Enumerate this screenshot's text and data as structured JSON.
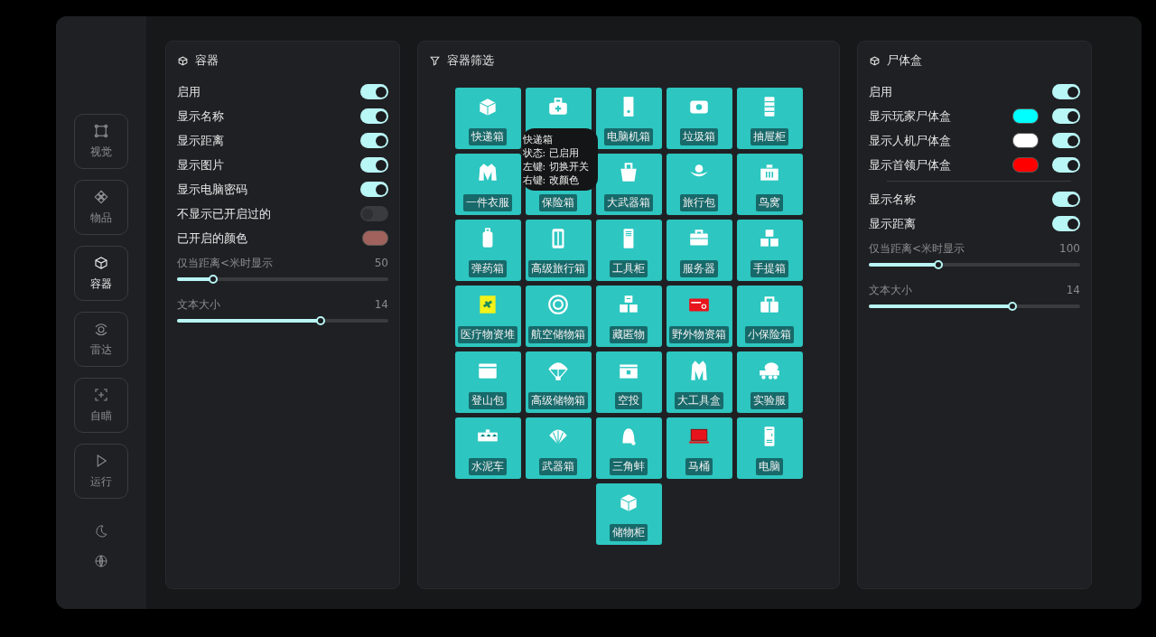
{
  "sidebar": {
    "items": [
      {
        "label": "视觉",
        "selected": false
      },
      {
        "label": "物品",
        "selected": false
      },
      {
        "label": "容器",
        "selected": true
      },
      {
        "label": "雷达",
        "selected": false
      },
      {
        "label": "自瞄",
        "selected": false
      },
      {
        "label": "运行",
        "selected": false
      }
    ]
  },
  "container_panel": {
    "title": "容器",
    "rows": [
      {
        "kind": "toggle",
        "label": "启用",
        "on": true
      },
      {
        "kind": "toggle",
        "label": "显示名称",
        "on": true
      },
      {
        "kind": "toggle",
        "label": "显示距离",
        "on": true
      },
      {
        "kind": "toggle",
        "label": "显示图片",
        "on": true
      },
      {
        "kind": "toggle",
        "label": "显示电脑密码",
        "on": true
      },
      {
        "kind": "toggle",
        "label": "不显示已开启过的",
        "on": false
      },
      {
        "kind": "color",
        "label": "已开启的颜色",
        "color": "#a0625c"
      }
    ],
    "sliders": [
      {
        "label": "仅当距离<米时显示",
        "reading": "50",
        "level": 0.17
      },
      {
        "label": "文本大小",
        "reading": "14",
        "level": 0.68
      }
    ]
  },
  "filter_panel": {
    "title": "容器筛选",
    "tiles": [
      {
        "kind": "labeled",
        "label": "快递箱"
      },
      {
        "kind": "icon_only"
      },
      {
        "kind": "labeled",
        "label": "电脑机箱"
      },
      {
        "kind": "labeled",
        "label": "垃圾箱"
      },
      {
        "kind": "labeled",
        "label": "抽屉柜"
      },
      {
        "kind": "labeled",
        "label": "一件衣服"
      },
      {
        "kind": "label_only",
        "label": "保险箱"
      },
      {
        "kind": "labeled",
        "label": "大武器箱"
      },
      {
        "kind": "labeled",
        "label": "旅行包"
      },
      {
        "kind": "labeled",
        "label": "鸟窝"
      },
      {
        "kind": "labeled",
        "label": "弹药箱"
      },
      {
        "kind": "labeled",
        "label": "高级旅行箱"
      },
      {
        "kind": "labeled",
        "label": "工具柜"
      },
      {
        "kind": "labeled",
        "label": "服务器"
      },
      {
        "kind": "labeled",
        "label": "手提箱"
      },
      {
        "kind": "labeled",
        "label": "医疗物资堆"
      },
      {
        "kind": "labeled",
        "label": "航空储物箱"
      },
      {
        "kind": "labeled",
        "label": "藏匿物"
      },
      {
        "kind": "labeled",
        "label": "野外物资箱"
      },
      {
        "kind": "labeled",
        "label": "小保险箱"
      },
      {
        "kind": "labeled",
        "label": "登山包"
      },
      {
        "kind": "labeled",
        "label": "高级储物箱"
      },
      {
        "kind": "labeled",
        "label": "空投"
      },
      {
        "kind": "labeled",
        "label": "大工具盒"
      },
      {
        "kind": "labeled",
        "label": "实验服"
      },
      {
        "kind": "labeled",
        "label": "水泥车"
      },
      {
        "kind": "labeled",
        "label": "武器箱"
      },
      {
        "kind": "labeled",
        "label": "三角蚌"
      },
      {
        "kind": "labeled",
        "label": "马桶"
      },
      {
        "kind": "labeled",
        "label": "电脑"
      },
      {
        "kind": "labeled",
        "label": "储物柜"
      }
    ],
    "tooltip": {
      "lines": [
        "快递箱",
        "状态: 已启用",
        "左键: 切换开关",
        "右键: 改颜色"
      ]
    }
  },
  "corpse_panel": {
    "title": "尸体盒",
    "rows": [
      {
        "kind": "toggle",
        "label": "启用",
        "on": true
      },
      {
        "kind": "color_toggle",
        "label": "显示玩家尸体盒",
        "color": "#00ffff",
        "on": true
      },
      {
        "kind": "color_toggle",
        "label": "显示人机尸体盒",
        "color": "#ffffff",
        "on": true
      },
      {
        "kind": "color_toggle",
        "label": "显示首领尸体盒",
        "color": "#ff0000",
        "on": true
      }
    ],
    "rows_after_divider": [
      {
        "kind": "toggle",
        "label": "显示名称",
        "on": true
      },
      {
        "kind": "toggle",
        "label": "显示距离",
        "on": true
      }
    ],
    "sliders": [
      {
        "label": "仅当距离<米时显示",
        "reading": "100",
        "level": 0.33
      },
      {
        "label": "文本大小",
        "reading": "14",
        "level": 0.68
      }
    ]
  }
}
